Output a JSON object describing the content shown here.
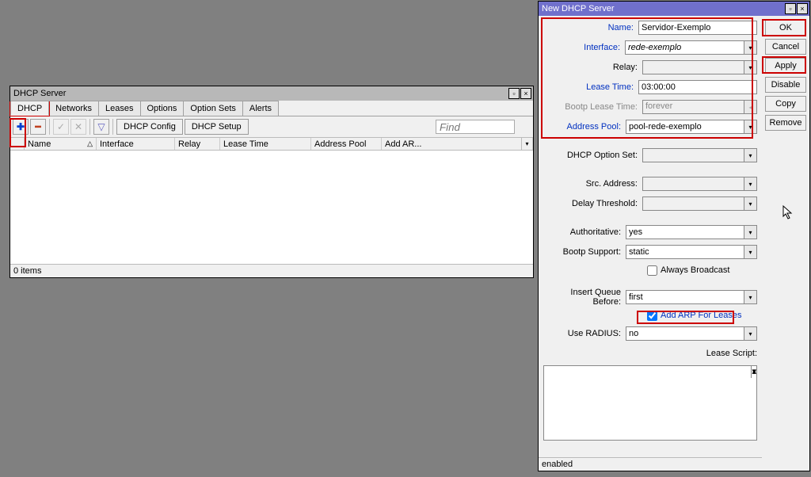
{
  "dhcp_window": {
    "title": "DHCP Server",
    "tabs": [
      "DHCP",
      "Networks",
      "Leases",
      "Options",
      "Option Sets",
      "Alerts"
    ],
    "active_tab": 0,
    "toolbar": {
      "dhcp_config": "DHCP Config",
      "dhcp_setup": "DHCP Setup",
      "find_placeholder": "Find"
    },
    "columns": [
      "",
      "Name",
      "Interface",
      "Relay",
      "Lease Time",
      "Address Pool",
      "Add AR..."
    ],
    "status": "0 items"
  },
  "dlg": {
    "title": "New DHCP Server",
    "buttons": {
      "ok": "OK",
      "cancel": "Cancel",
      "apply": "Apply",
      "disable": "Disable",
      "copy": "Copy",
      "remove": "Remove"
    },
    "fields": {
      "name": {
        "label": "Name:",
        "value": "Servidor-Exemplo"
      },
      "interface": {
        "label": "Interface:",
        "value": "rede-exemplo"
      },
      "relay": {
        "label": "Relay:",
        "value": ""
      },
      "lease_time": {
        "label": "Lease Time:",
        "value": "03:00:00"
      },
      "bootp_lease": {
        "label": "Bootp Lease Time:",
        "value": "forever"
      },
      "address_pool": {
        "label": "Address Pool:",
        "value": "pool-rede-exemplo"
      },
      "dhcp_option_set": {
        "label": "DHCP Option Set:",
        "value": ""
      },
      "src_address": {
        "label": "Src. Address:",
        "value": ""
      },
      "delay_threshold": {
        "label": "Delay Threshold:",
        "value": ""
      },
      "authoritative": {
        "label": "Authoritative:",
        "value": "yes"
      },
      "bootp_support": {
        "label": "Bootp Support:",
        "value": "static"
      },
      "always_broadcast": {
        "label": "Always Broadcast",
        "checked": false
      },
      "insert_queue": {
        "label": "Insert Queue Before:",
        "value": "first"
      },
      "add_arp": {
        "label": "Add ARP For Leases",
        "checked": true
      },
      "use_radius": {
        "label": "Use RADIUS:",
        "value": "no"
      },
      "lease_script": {
        "label": "Lease Script:"
      }
    },
    "status": "enabled"
  }
}
